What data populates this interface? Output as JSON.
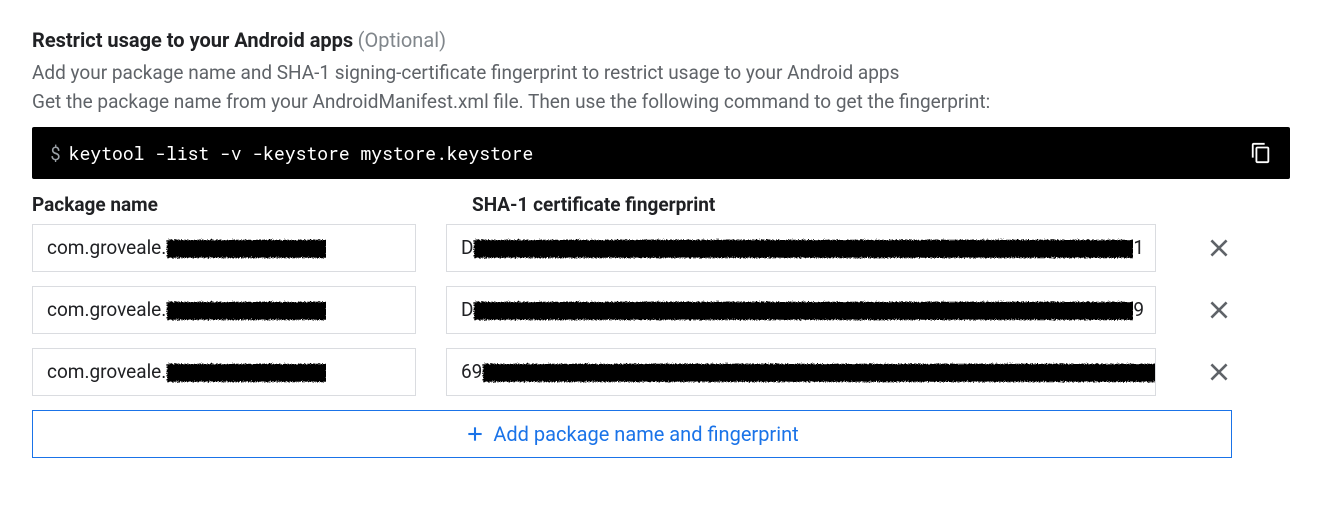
{
  "heading": {
    "title": "Restrict usage to your Android apps",
    "optional_label": "(Optional)"
  },
  "description": {
    "line1": "Add your package name and SHA-1 signing-certificate fingerprint to restrict usage to your Android apps",
    "line2": "Get the package name from your AndroidManifest.xml file. Then use the following command to get the fingerprint:"
  },
  "code_block": {
    "prompt": "$",
    "command": "keytool -list -v -keystore mystore.keystore"
  },
  "columns": {
    "package_name": "Package name",
    "fingerprint": "SHA-1 certificate fingerprint"
  },
  "entries": [
    {
      "package_prefix": "com.groveale.",
      "fp_prefix": "D",
      "fp_suffix": "1"
    },
    {
      "package_prefix": "com.groveale.",
      "fp_prefix": "D",
      "fp_suffix": "9"
    },
    {
      "package_prefix": "com.groveale.",
      "fp_prefix": "69",
      "fp_suffix": ""
    }
  ],
  "add_button": {
    "label": "Add package name and fingerprint"
  }
}
